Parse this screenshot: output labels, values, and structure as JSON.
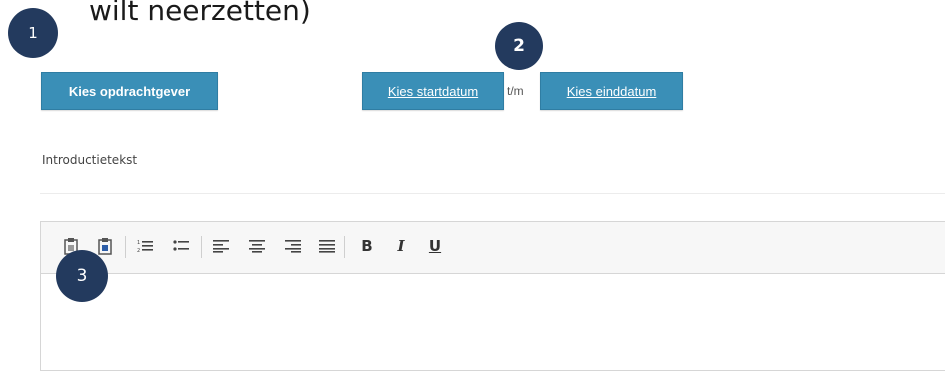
{
  "heading": "wilt neerzetten)",
  "badges": [
    "1",
    "2",
    "3"
  ],
  "buttons": {
    "opdrachtgever": "Kies opdrachtgever",
    "startdatum": "Kies startdatum",
    "separator": "t/m",
    "einddatum": "Kies einddatum"
  },
  "intro_label": "Introductietekst",
  "toolbar": {
    "icons": [
      "paste-icon",
      "paste-from-word-icon",
      "numbered-list-icon",
      "bulleted-list-icon",
      "align-left-icon",
      "align-center-icon",
      "align-right-icon",
      "justify-icon",
      "bold-icon",
      "italic-icon",
      "underline-icon"
    ],
    "bold": "B",
    "italic": "I",
    "underline": "U"
  },
  "colors": {
    "button": "#3a8fb7",
    "badge": "#233a5e"
  }
}
